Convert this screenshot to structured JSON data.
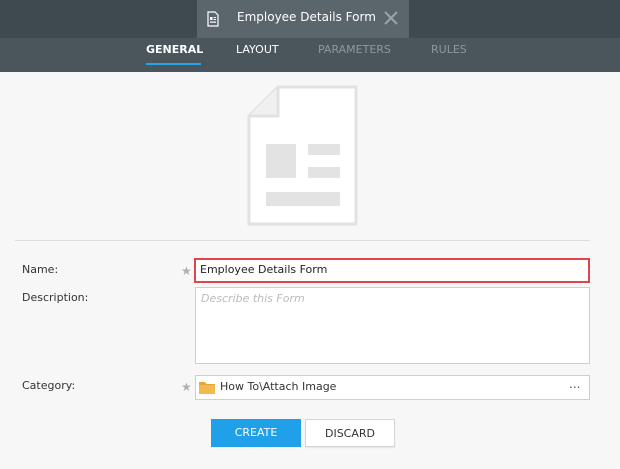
{
  "window": {
    "tab_title": "Employee Details Form",
    "tab_icon": "form-document-icon",
    "close_icon": "close-icon"
  },
  "nav": {
    "tabs": [
      {
        "label": "GENERAL",
        "state": "active"
      },
      {
        "label": "LAYOUT",
        "state": "enabled"
      },
      {
        "label": "PARAMETERS",
        "state": "disabled"
      },
      {
        "label": "RULES",
        "state": "disabled"
      }
    ]
  },
  "form": {
    "name_label": "Name:",
    "name_value": "Employee Details Form",
    "description_label": "Description:",
    "description_placeholder": "Describe this Form",
    "category_label": "Category:",
    "category_value": "How To\\Attach Image",
    "category_more": "...",
    "required_marker": "★"
  },
  "actions": {
    "create_label": "CREATE",
    "discard_label": "DISCARD"
  },
  "colors": {
    "top_bar": "#3f4a50",
    "active_tab_bg": "#5b666c",
    "accent": "#1fa0e8",
    "error_border": "#e0454a",
    "folder": "#e8a33d"
  }
}
